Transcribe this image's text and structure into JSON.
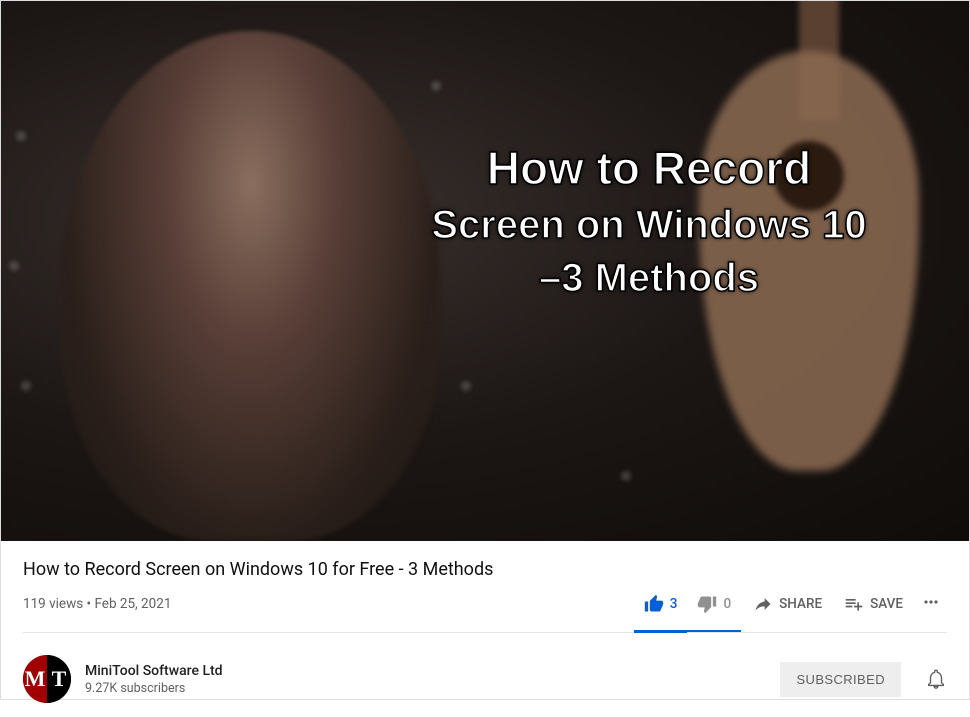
{
  "thumbnail_overlay": {
    "line1": "How to Record",
    "line2": "Screen on Windows 10",
    "line3": "–3 Methods"
  },
  "video": {
    "title": "How to Record Screen on Windows 10 for Free - 3 Methods",
    "views": "119 views",
    "date": "Feb 25, 2021",
    "separator": " • "
  },
  "actions": {
    "likes": "3",
    "dislikes": "0",
    "share": "SHARE",
    "save": "SAVE"
  },
  "channel": {
    "name": "MiniTool Software Ltd",
    "subscribers": "9.27K subscribers",
    "avatar_left": "M",
    "avatar_right": "T",
    "subscribe_label": "SUBSCRIBED"
  }
}
